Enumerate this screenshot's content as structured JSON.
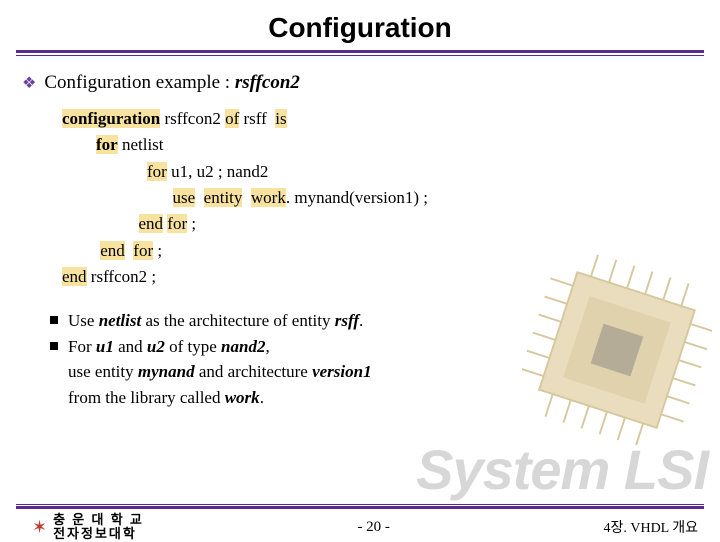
{
  "title": "Configuration",
  "bullet1_prefix": "Configuration example : ",
  "bullet1_name": "rsffcon2",
  "code": {
    "l1_kw": "configuration",
    "l1_a": " rsffcon2 ",
    "l1_of": "of",
    "l1_b": " rsff  ",
    "l1_is": "is",
    "l2_for": "for",
    "l2_a": " netlist",
    "l3_for": "for",
    "l3_a": " u1, u2 ; nand2",
    "l4_use": "use",
    "l4_a": "  ",
    "l4_ent": "entity",
    "l4_b": "  ",
    "l4_work": "work",
    "l4_c": ". mynand(version1) ;",
    "l5_end": "end",
    "l5_a": " ",
    "l5_for": "for",
    "l5_b": " ;",
    "l6_end": "end",
    "l6_a": "  ",
    "l6_for": "for",
    "l6_b": " ;",
    "l7_end": "end",
    "l7_a": " rsffcon2 ;"
  },
  "explain": {
    "b1_a": "Use ",
    "b1_netlist": "netlist",
    "b1_b": " as the architecture of entity ",
    "b1_rsff": "rsff",
    "b1_c": ".",
    "b2_a": "For ",
    "b2_u1": "u1",
    "b2_b": " and ",
    "b2_u2": "u2",
    "b2_c": " of type ",
    "b2_nand2": "nand2",
    "b2_d": ",",
    "b3_a": "use entity ",
    "b3_mynand": "mynand",
    "b3_b": " and architecture ",
    "b3_ver": "version1",
    "b4_a": "from the library called ",
    "b4_work": "work",
    "b4_b": "."
  },
  "watermark": "System LSI",
  "footer": {
    "univ_line1": "충 운 대 학 교",
    "univ_line2": "전자정보대학",
    "page": "-  20  -",
    "chapter": "4장. VHDL 개요"
  }
}
